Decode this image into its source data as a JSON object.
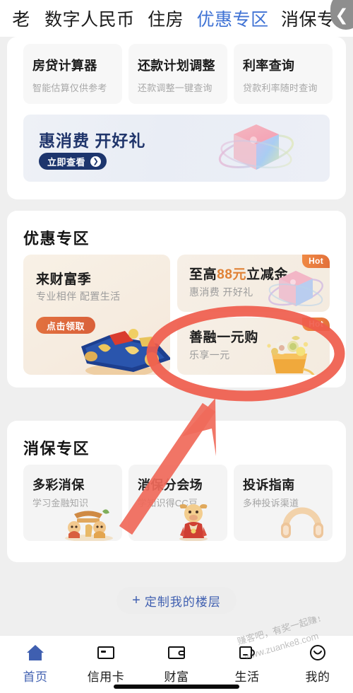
{
  "top_tabs": {
    "items": [
      {
        "label": "老",
        "active": false,
        "partial": true
      },
      {
        "label": "数字人民币",
        "active": false
      },
      {
        "label": "住房",
        "active": false
      },
      {
        "label": "优惠专区",
        "active": true
      },
      {
        "label": "消保专区",
        "active": false
      }
    ],
    "collapse_icon": "❮",
    "active_color": "#3f72d4"
  },
  "tools_card": {
    "items": [
      {
        "title": "房贷计算器",
        "subtitle": "智能估算仅供参考"
      },
      {
        "title": "还款计划调整",
        "subtitle": "还款调整一键查询"
      },
      {
        "title": "利率查询",
        "subtitle": "贷款利率随时查询"
      }
    ],
    "banner": {
      "title": "惠消费 开好礼",
      "button_label": "立即查看",
      "button_arrow": "❯",
      "art": "gift-cube-illustration"
    }
  },
  "youhui_section": {
    "title": "优惠专区",
    "left_card": {
      "title": "来财富季",
      "subtitle": "专业相伴 配置生活",
      "button_label": "点击领取",
      "art": "caifuji-gold-coin-illustration"
    },
    "right_cards": [
      {
        "title_prefix": "至高",
        "title_amount": "88元",
        "title_suffix": "立减金",
        "subtitle": "惠消费 开好礼",
        "badge": "Hot",
        "art": "gift-cube-illustration"
      },
      {
        "title": "善融一元购",
        "subtitle": "乐享一元",
        "badge": "Hot",
        "art": "grocery-basket-illustration",
        "highlighted": true
      }
    ]
  },
  "xiaobao_section": {
    "title": "消保专区",
    "items": [
      {
        "title": "多彩消保",
        "subtitle": "学习金融知识",
        "art": "mascot-pair-illustration"
      },
      {
        "title": "消保分会场",
        "subtitle": "学知识得CC豆",
        "art": "ox-mascot-illustration"
      },
      {
        "title": "投诉指南",
        "subtitle": "多种投诉渠道",
        "art": "headset-illustration"
      }
    ]
  },
  "customize_button": {
    "plus": "+",
    "label": "定制我的楼层"
  },
  "bottom_nav": {
    "items": [
      {
        "label": "首页",
        "icon": "home-icon",
        "active": true
      },
      {
        "label": "信用卡",
        "icon": "credit-card-icon",
        "active": false
      },
      {
        "label": "财富",
        "icon": "wallet-icon",
        "active": false
      },
      {
        "label": "生活",
        "icon": "cup-icon",
        "active": false
      },
      {
        "label": "我的",
        "icon": "smiley-face-icon",
        "active": false
      }
    ],
    "active_color": "#3f5fb0"
  },
  "annotations": {
    "circle_color": "#ef5c4c",
    "arrow_color": "#f06a5a",
    "target": "善融一元购"
  },
  "watermark": {
    "line1": "赚客吧，有奖一起赚！",
    "line2": "www.zuanke8.com"
  }
}
